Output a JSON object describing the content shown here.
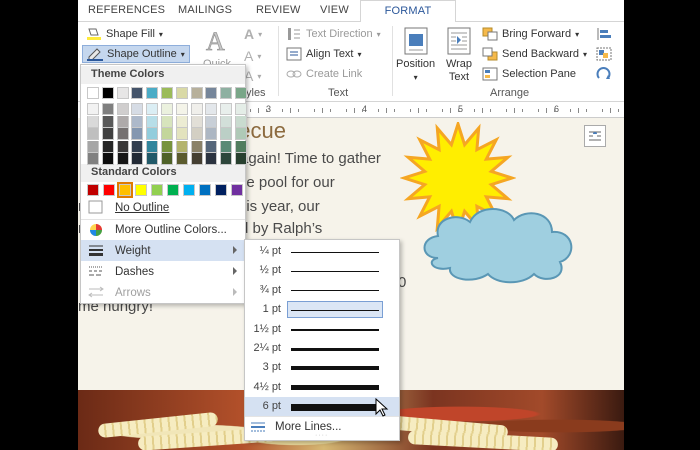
{
  "tabs": [
    "REFERENCES",
    "MAILINGS",
    "REVIEW",
    "VIEW",
    "FORMAT"
  ],
  "ribbon": {
    "shape_fill": "Shape Fill",
    "shape_outline": "Shape Outline",
    "quick_partial": "Quick",
    "styles_partial": "yles",
    "text_direction": "Text Direction",
    "align_text": "Align Text",
    "create_link": "Create Link",
    "text_group": "Text",
    "position": "Position",
    "wrap_text_1": "Wrap",
    "wrap_text_2": "Text",
    "bring_forward": "Bring Forward",
    "send_backward": "Send Backward",
    "selection_pane": "Selection Pane",
    "arrange_group": "Arrange"
  },
  "ruler_numbers": [
    "3",
    "4",
    "5",
    "6"
  ],
  "document": {
    "heading_partial": "becue",
    "lines": [
      "again! Time to gather",
      "he pool for our",
      "his year, our",
      "d by Ralph’s"
    ],
    "left_fragments": [
      "r",
      "r"
    ],
    "bottom_line": "me hungry!",
    "right_fragment": "0"
  },
  "outline_menu": {
    "theme_colors_title": "Theme Colors",
    "standard_colors_title": "Standard Colors",
    "no_outline": "No Outline",
    "more_outline_colors": "More Outline Colors...",
    "weight": "Weight",
    "dashes": "Dashes",
    "arrows": "Arrows"
  },
  "theme_colors": {
    "top_row": [
      "#ffffff",
      "#000000",
      "#e7e6e6",
      "#44546a",
      "#4bacc6",
      "#9bbb59",
      "#d9d9a6",
      "#b7b09b",
      "#76869a",
      "#8eb0a1",
      "#79a688"
    ],
    "columns": [
      [
        "#f2f2f2",
        "#d9d9d9",
        "#bfbfbf",
        "#a6a6a6",
        "#808080"
      ],
      [
        "#7f7f7f",
        "#595959",
        "#404040",
        "#262626",
        "#0d0d0d"
      ],
      [
        "#d0cece",
        "#aeaaaa",
        "#757171",
        "#3a3838",
        "#161616"
      ],
      [
        "#d6dce5",
        "#adb9ca",
        "#8497b0",
        "#323f4f",
        "#222a35"
      ],
      [
        "#dbeef4",
        "#b7dee8",
        "#92cddc",
        "#31859c",
        "#215968"
      ],
      [
        "#ebf1de",
        "#d7e4bd",
        "#c3d69b",
        "#77933c",
        "#4f6228"
      ],
      [
        "#f4f4e9",
        "#ececd3",
        "#e3e3be",
        "#b3b36d",
        "#5c5c2f"
      ],
      [
        "#f0efeb",
        "#e2dfd7",
        "#d3cfc3",
        "#8a8168",
        "#453f32"
      ],
      [
        "#e3e7eb",
        "#c8cfd7",
        "#adb7c3",
        "#55667a",
        "#2b3340"
      ],
      [
        "#e8efec",
        "#d2dfd9",
        "#bbcfc6",
        "#5a8a76",
        "#2d463b"
      ],
      [
        "#e4ede7",
        "#c9dbcf",
        "#afc9b7",
        "#517d5f",
        "#28402f"
      ]
    ]
  },
  "standard_colors": [
    "#c00000",
    "#ff0000",
    "#ffc000",
    "#ffff00",
    "#92d050",
    "#00b050",
    "#00b0f0",
    "#0070c0",
    "#002060",
    "#7030a0"
  ],
  "weight_menu": {
    "options": [
      {
        "label": "¼ pt",
        "weight": 0.25
      },
      {
        "label": "½ pt",
        "weight": 0.5
      },
      {
        "label": "¾ pt",
        "weight": 0.75
      },
      {
        "label": "1 pt",
        "weight": 1
      },
      {
        "label": "1½ pt",
        "weight": 1.5
      },
      {
        "label": "2¼ pt",
        "weight": 2.25
      },
      {
        "label": "3 pt",
        "weight": 3
      },
      {
        "label": "4½ pt",
        "weight": 4.5
      },
      {
        "label": "6 pt",
        "weight": 6
      }
    ],
    "selected": "1 pt",
    "hovered": "6 pt",
    "more_lines": "More Lines..."
  },
  "colors": {
    "accent_blue": "#2b579a",
    "highlight": "#d5e1f2",
    "sun_yellow": "#ffee00",
    "sun_orange": "#f5a623",
    "cloud_fill": "#9fcfe0",
    "cloud_stroke": "#5a97b5"
  }
}
